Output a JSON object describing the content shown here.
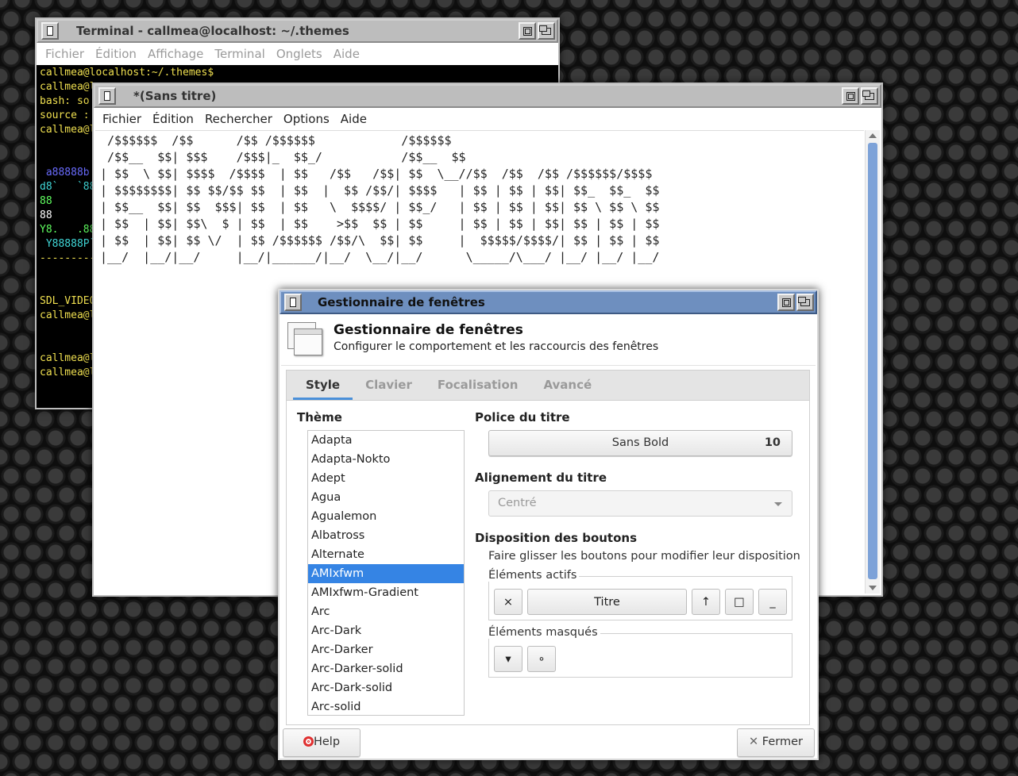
{
  "terminal": {
    "title": "Terminal - callmea@localhost: ~/.themes",
    "menu": [
      "Fichier",
      "Édition",
      "Affichage",
      "Terminal",
      "Onglets",
      "Aide"
    ],
    "lines": [
      {
        "text": "callmea@localhost:~/.themes$",
        "color": "y"
      },
      {
        "text": "callmea@l",
        "color": "y"
      },
      {
        "text": "bash: so",
        "color": "y"
      },
      {
        "text": "source :",
        "color": "y"
      },
      {
        "text": "callmea@l",
        "color": "y"
      },
      {
        "text": "",
        "color": "w"
      },
      {
        "text": "",
        "color": "w"
      },
      {
        "text": " a88888b",
        "color": "b"
      },
      {
        "text": "d8`   `88",
        "color": "c"
      },
      {
        "text": "88",
        "color": "g"
      },
      {
        "text": "88",
        "color": "w"
      },
      {
        "text": "Y8.   .88",
        "color": "g"
      },
      {
        "text": " Y88888P`",
        "color": "c"
      },
      {
        "text": "---------",
        "color": "y"
      },
      {
        "text": "",
        "color": "w"
      },
      {
        "text": "",
        "color": "w"
      },
      {
        "text": "SDL_VIDEO",
        "color": "y"
      },
      {
        "text": "callmea@l",
        "color": "y"
      },
      {
        "text": "",
        "color": "w"
      },
      {
        "text": "",
        "color": "w"
      },
      {
        "text": "callmea@l",
        "color": "y"
      },
      {
        "text": "callmea@l",
        "color": "y"
      }
    ]
  },
  "editor": {
    "title": "*(Sans titre)",
    "menu": [
      "Fichier",
      "Édition",
      "Rechercher",
      "Options",
      "Aide"
    ],
    "content": " /$$$$$$  /$$      /$$ /$$$$$$            /$$$$$$\n /$$__  $$| $$$    /$$$|_  $$_/           /$$__  $$\n| $$  \\ $$| $$$$  /$$$$  | $$   /$$   /$$| $$  \\__//$$  /$$  /$$ /$$$$$$/$$$$\n| $$$$$$$$| $$ $$/$$ $$  | $$  |  $$ /$$/| $$$$   | $$ | $$ | $$| $$_  $$_  $$\n| $$__  $$| $$  $$$| $$  | $$   \\  $$$$/ | $$_/   | $$ | $$ | $$| $$ \\ $$ \\ $$\n| $$  | $$| $$\\  $ | $$  | $$    >$$  $$ | $$     | $$ | $$ | $$| $$ | $$ | $$\n| $$  | $$| $$ \\/  | $$ /$$$$$$ /$$/\\  $$| $$     |  $$$$$/$$$$/| $$ | $$ | $$\n|__/  |__/|__/     |__/|______/|__/  \\__/|__/      \\_____/\\___/ |__/ |__/ |__/"
  },
  "wm": {
    "window_title": "Gestionnaire de fenêtres",
    "header_title": "Gestionnaire de fenêtres",
    "header_subtitle": "Configurer le comportement et les raccourcis des fenêtres",
    "tabs": [
      "Style",
      "Clavier",
      "Focalisation",
      "Avancé"
    ],
    "active_tab": "Style",
    "theme_label": "Thème",
    "themes": [
      "Adapta",
      "Adapta-Nokto",
      "Adept",
      "Agua",
      "Agualemon",
      "Albatross",
      "Alternate",
      "AMIxfwm",
      "AMIxfwm-Gradient",
      "Arc",
      "Arc-Dark",
      "Arc-Darker",
      "Arc-Darker-solid",
      "Arc-Dark-solid",
      "Arc-solid"
    ],
    "selected_theme": "AMIxfwm",
    "font_label": "Police du titre",
    "font_name": "Sans Bold",
    "font_size": "10",
    "align_label": "Alignement du titre",
    "align_value": "Centré",
    "layout_label": "Disposition des boutons",
    "layout_hint": "Faire glisser les boutons pour modifier leur disposition",
    "active_label": "Éléments actifs",
    "hidden_label": "Éléments masqués",
    "active_buttons": {
      "close": "×",
      "title": "Titre",
      "maximize": "↑",
      "restore": "□",
      "minimize": "_"
    },
    "hidden_buttons": {
      "shade": "▾",
      "stick": "∘"
    },
    "help_label": "Help",
    "close_label": "Fermer"
  },
  "colors": {
    "accent": "#3584e4",
    "active_titlebar": "#6e8fbf",
    "terminal_prompt": "#f0e050"
  }
}
